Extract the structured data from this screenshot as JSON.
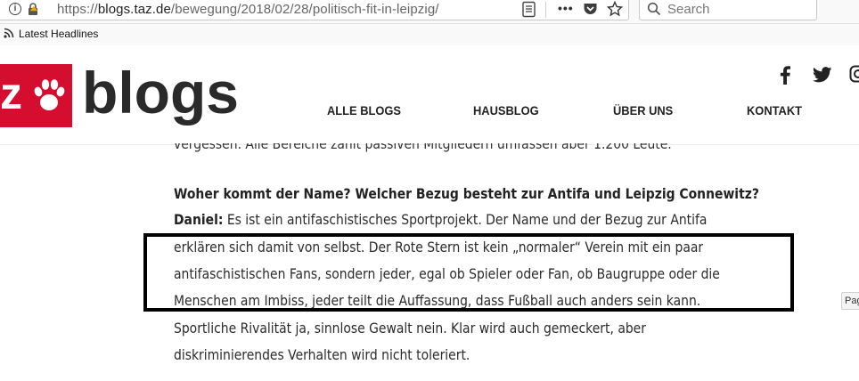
{
  "browser": {
    "url": {
      "scheme": "https://",
      "host": "blogs.taz.de",
      "path": "/bewegung/2018/02/28/politisch-fit-in-leipzig/"
    },
    "search_placeholder": "Search",
    "bookmark_label": "Latest Headlines",
    "icons": [
      "info-icon",
      "lock-icon",
      "reader-view-icon",
      "more-icon",
      "pocket-icon",
      "star-icon",
      "search-icon",
      "rss-icon"
    ]
  },
  "site": {
    "logo_letter": "z",
    "logo_text": "blogs",
    "brand_color": "#d50d2e",
    "nav": [
      {
        "label": "ALLE BLOGS"
      },
      {
        "label": "HAUSBLOG"
      },
      {
        "label": "ÜBER UNS"
      },
      {
        "label": "KONTAKT"
      }
    ],
    "social_icons": [
      "facebook-icon",
      "twitter-icon",
      "instagram-icon"
    ]
  },
  "article": {
    "cut_line": "vergessen. Alle Bereiche zählt passiven Mitgliedern umfassen aber 1.200 Leute.",
    "question": "Woher kommt der Name? Welcher Bezug besteht zur Antifa und Leipzig Connewitz?",
    "speaker": "Daniel:",
    "answer_lines": [
      " Es ist ein antifaschistisches Sportprojekt. Der Name und der Bezug zur Antifa",
      "erklären sich damit von selbst. Der Rote Stern ist kein „normaler“ Verein mit ein paar",
      "antifaschistischen Fans, sondern jeder, egal ob Spieler oder Fan, ob Baugruppe oder die",
      "Menschen am Imbiss, jeder teilt die Auffassung, dass Fußball auch anders sein kann.",
      "Sportliche Rivalität ja, sinnlose Gewalt nein. Klar wird auch gemeckert, aber",
      "diskriminierendes Verhalten wird nicht toleriert."
    ]
  },
  "page_tab_label": "Pag"
}
